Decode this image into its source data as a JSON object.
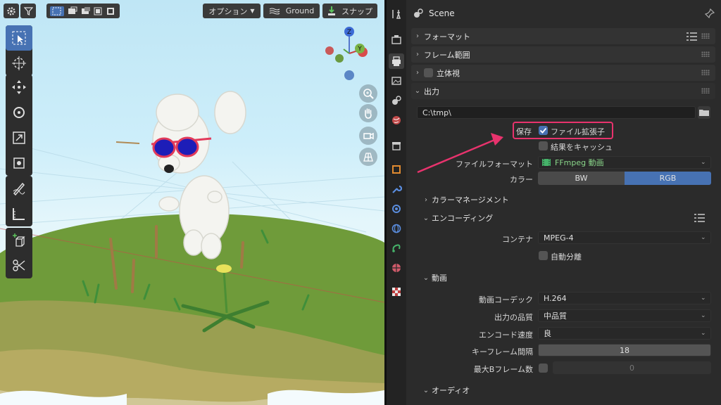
{
  "viewport": {
    "toolbar": {
      "options_label": "オプション",
      "orientation_label": "Ground",
      "snap_label": "スナップ"
    },
    "gizmo": {
      "x": "X",
      "y": "Y",
      "z": "Z"
    }
  },
  "properties": {
    "scene_label": "Scene",
    "panels": {
      "format": "フォーマット",
      "frame_range": "フレーム範囲",
      "stereoscopy": "立体視",
      "output": "出力"
    },
    "output": {
      "path": "C:\\tmp\\",
      "save_label": "保存",
      "file_extensions_label": "ファイル拡張子",
      "cache_result_label": "結果をキャッシュ",
      "file_format_label": "ファイルフォーマット",
      "file_format_value": "FFmpeg 動画",
      "color_label": "カラー",
      "color_options": [
        "BW",
        "RGB"
      ],
      "color_selected": "RGB",
      "color_management": "カラーマネージメント",
      "encoding": "エンコーディング",
      "container_label": "コンテナ",
      "container_value": "MPEG-4",
      "autosplit_label": "自動分離",
      "video": "動画",
      "video_codec_label": "動画コーデック",
      "video_codec_value": "H.264",
      "quality_label": "出力の品質",
      "quality_value": "中品質",
      "speed_label": "エンコード速度",
      "speed_value": "良",
      "keyframe_label": "キーフレーム間隔",
      "keyframe_value": "18",
      "max_b_label": "最大Bフレーム数",
      "max_b_value": "0",
      "audio": "オーディオ"
    }
  },
  "colors": {
    "accent": "#4772b3",
    "highlight": "#e8336d",
    "panel_bg": "#2b2b2b"
  }
}
